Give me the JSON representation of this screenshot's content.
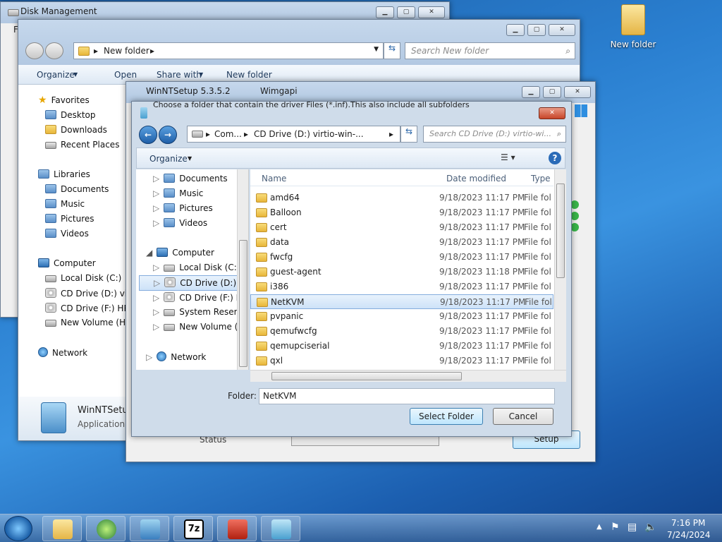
{
  "desktop": {
    "icon_label": "New folder"
  },
  "disk_mgmt": {
    "title": "Disk Management",
    "menu_first": "F"
  },
  "explorer": {
    "address": "New folder",
    "search_placeholder": "Search New folder",
    "toolbar": {
      "organize": "Organize",
      "open": "Open",
      "share": "Share with",
      "new_folder": "New folder"
    },
    "nav": {
      "favorites": "Favorites",
      "desktop": "Desktop",
      "downloads": "Downloads",
      "recent": "Recent Places",
      "libraries": "Libraries",
      "documents": "Documents",
      "music": "Music",
      "pictures": "Pictures",
      "videos": "Videos",
      "computer": "Computer",
      "local_c": "Local Disk (C:)",
      "cd_d": "CD Drive (D:) virtio",
      "cd_f": "CD Drive (F:) HRM",
      "vol_h": "New Volume (H:)",
      "network": "Network"
    },
    "details": {
      "name": "WinNTSetup",
      "type": "Application"
    }
  },
  "winnt": {
    "title": "WinNTSetup 5.3.5.2",
    "subtitle": "Wimgapi",
    "status": "Status",
    "setup": "Setup"
  },
  "dialog": {
    "title": "Choose a folder that contain the driver Files (*.inf).This also include all subfolders",
    "address": {
      "seg1": "Com...",
      "seg2": "CD Drive (D:) virtio-win-..."
    },
    "search_placeholder": "Search CD Drive (D:) virtio-wi...",
    "organize": "Organize",
    "nav": {
      "documents": "Documents",
      "music": "Music",
      "pictures": "Pictures",
      "videos": "Videos",
      "computer": "Computer",
      "local_c": "Local Disk (C:)",
      "cd_d": "CD Drive (D:) virt",
      "cd_f": "CD Drive (F:) HRM",
      "sys": "System Reserved",
      "vol_h": "New Volume (H:)",
      "network": "Network"
    },
    "columns": {
      "name": "Name",
      "date": "Date modified",
      "type": "Type"
    },
    "files": [
      {
        "name": "amd64",
        "date": "9/18/2023 11:17 PM",
        "type": "File fol"
      },
      {
        "name": "Balloon",
        "date": "9/18/2023 11:17 PM",
        "type": "File fol"
      },
      {
        "name": "cert",
        "date": "9/18/2023 11:17 PM",
        "type": "File fol"
      },
      {
        "name": "data",
        "date": "9/18/2023 11:17 PM",
        "type": "File fol"
      },
      {
        "name": "fwcfg",
        "date": "9/18/2023 11:17 PM",
        "type": "File fol"
      },
      {
        "name": "guest-agent",
        "date": "9/18/2023 11:18 PM",
        "type": "File fol"
      },
      {
        "name": "i386",
        "date": "9/18/2023 11:17 PM",
        "type": "File fol"
      },
      {
        "name": "NetKVM",
        "date": "9/18/2023 11:17 PM",
        "type": "File fol"
      },
      {
        "name": "pvpanic",
        "date": "9/18/2023 11:17 PM",
        "type": "File fol"
      },
      {
        "name": "qemufwcfg",
        "date": "9/18/2023 11:17 PM",
        "type": "File fol"
      },
      {
        "name": "qemupciserial",
        "date": "9/18/2023 11:17 PM",
        "type": "File fol"
      },
      {
        "name": "qxl",
        "date": "9/18/2023 11:17 PM",
        "type": "File fol"
      }
    ],
    "selected_index": 7,
    "folder_label": "Folder:",
    "folder_value": "NetKVM",
    "select_btn": "Select Folder",
    "cancel_btn": "Cancel"
  },
  "taskbar": {
    "apps": [
      "explorer",
      "media-center",
      "control-panel",
      "7zip",
      "toolbox",
      "winntsetup"
    ],
    "app_7z": "7z",
    "time": "7:16 PM",
    "date": "7/24/2024"
  }
}
